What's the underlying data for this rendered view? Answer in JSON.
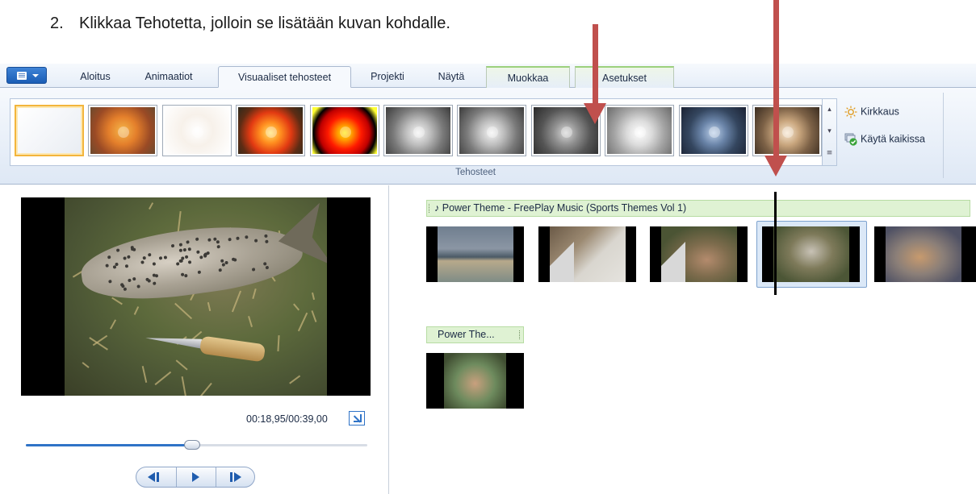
{
  "instruction": {
    "number": "2.",
    "text": "Klikkaa Tehotetta, jolloin se lisätään kuvan kohdalle."
  },
  "ribbon": {
    "tabs": [
      "Aloitus",
      "Animaatiot",
      "Visuaaliset tehosteet",
      "Projekti",
      "Näytä",
      "Muokkaa",
      "Asetukset"
    ],
    "active_tab": "Visuaaliset tehosteet",
    "group_label": "Tehosteet",
    "brightness_label": "Kirkkaus",
    "apply_all_label": "Käytä kaikissa",
    "effects": [
      {
        "name": "no-effect",
        "style": "none"
      },
      {
        "name": "blur",
        "style": "blur"
      },
      {
        "name": "edge",
        "style": "edge"
      },
      {
        "name": "warm",
        "style": "warm"
      },
      {
        "name": "posterize",
        "style": "posterize"
      },
      {
        "name": "grayscale-1",
        "style": "gray"
      },
      {
        "name": "grayscale-2",
        "style": "gray"
      },
      {
        "name": "grayscale-3",
        "style": "gray-dark"
      },
      {
        "name": "grayscale-4",
        "style": "gray-light"
      },
      {
        "name": "cyan-tone",
        "style": "cyan"
      },
      {
        "name": "sepia",
        "style": "sepia"
      }
    ]
  },
  "preview": {
    "time": "00:18,95/00:39,00",
    "seek_progress": 0.486
  },
  "storyboard": {
    "music_row1": "Power Theme - FreePlay Music (Sports Themes Vol 1)",
    "music_row2": "Power The...",
    "selected_clip_index": 3
  },
  "colors": {
    "arrow": "#c0504d",
    "accent": "#2f73c7",
    "selection": "#f3b53c",
    "music_track": "#dff2d3"
  }
}
